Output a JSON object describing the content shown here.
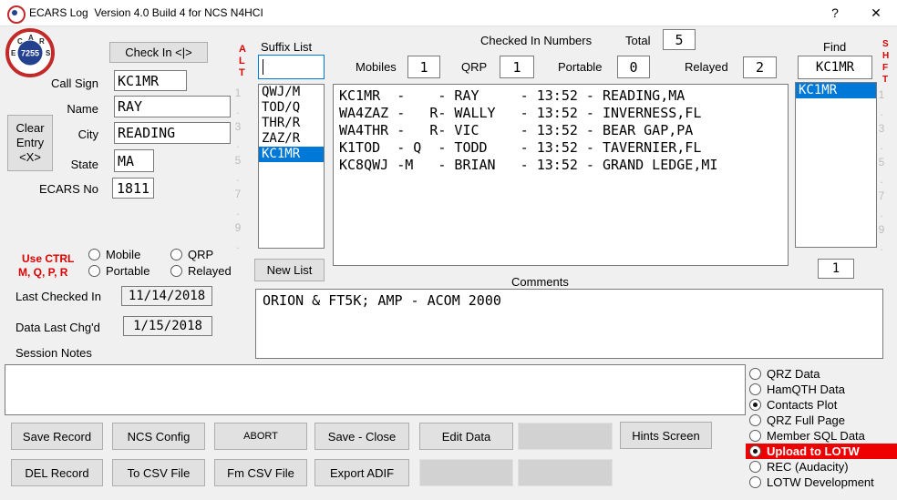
{
  "window": {
    "title": "ECARS Log  Version 4.0 Build 4 for NCS N4HCI",
    "help": "?",
    "close": "✕"
  },
  "colors": {
    "accent_blue": "#0078d7",
    "alert_red": "#dd0000",
    "lotw_highlight_bg": "#ee0000"
  },
  "logo": {
    "number": "7255",
    "letters": [
      "E",
      "C",
      "A",
      "R",
      "S"
    ]
  },
  "left_form": {
    "check_in_button": "Check In <|>",
    "clear_entry": [
      "Clear",
      "Entry",
      "<X>"
    ],
    "fields": {
      "call_sign": {
        "label": "Call Sign",
        "value": "KC1MR"
      },
      "name": {
        "label": "Name",
        "value": "RAY"
      },
      "city": {
        "label": "City",
        "value": "READING"
      },
      "state": {
        "label": "State",
        "value": "MA"
      },
      "ecars_no": {
        "label": "ECARS No",
        "value": "1811"
      }
    }
  },
  "alt_hint": {
    "letters": [
      "A",
      "L",
      "T"
    ]
  },
  "shft_hint": {
    "letters": [
      "S",
      "H",
      "F",
      "T"
    ]
  },
  "row_numbers": [
    "1",
    ".",
    "3",
    ".",
    "5",
    ".",
    "7",
    ".",
    "9",
    "."
  ],
  "suffix_panel": {
    "label": "Suffix List",
    "input_value": "",
    "items": [
      "QWJ/M",
      "TOD/Q",
      "THR/R",
      "ZAZ/R",
      "KC1MR"
    ],
    "new_list_button": "New List"
  },
  "stats": {
    "header": "Checked In Numbers",
    "total_label": "Total",
    "total_value": "5",
    "counters": [
      {
        "label": "Mobiles",
        "value": "1"
      },
      {
        "label": "QRP",
        "value": "1"
      },
      {
        "label": "Portable",
        "value": "0"
      },
      {
        "label": "Relayed",
        "value": "2"
      }
    ]
  },
  "checkin_list": {
    "rows": [
      "KC1MR  -    - RAY     - 13:52 - READING,MA",
      "WA4ZAZ -   R- WALLY   - 13:52 - INVERNESS,FL",
      "WA4THR -   R- VIC     - 13:52 - BEAR GAP,PA",
      "K1TOD  - Q  - TODD    - 13:52 - TAVERNIER,FL",
      "KC8QWJ -M   - BRIAN   - 13:52 - GRAND LEDGE,MI"
    ]
  },
  "find_panel": {
    "label": "Find",
    "input_value": "KC1MR",
    "items": [
      "KC1MR"
    ],
    "count_value": "1"
  },
  "status_radios": {
    "hint_line1": "Use CTRL",
    "hint_line2": "M, Q, P, R",
    "options": [
      "Mobile",
      "QRP",
      "Portable",
      "Relayed"
    ]
  },
  "dates": {
    "last_checked_label": "Last Checked In",
    "last_checked_value": "11/14/2018",
    "data_changed_label": "Data Last Chg'd",
    "data_changed_value": "1/15/2018"
  },
  "comments": {
    "label": "Comments",
    "value": "ORION & FT5K; AMP - ACOM 2000"
  },
  "session_notes": {
    "label": "Session Notes",
    "value": ""
  },
  "buttons": {
    "row1": [
      "Save Record",
      "NCS Config",
      "ABORT",
      "Save - Close",
      "Edit Data",
      "",
      "Hints Screen"
    ],
    "row2": [
      "DEL Record",
      "To CSV File",
      "Fm CSV File",
      "Export ADIF",
      "",
      ""
    ]
  },
  "output_radios": {
    "options": [
      {
        "label": "QRZ Data",
        "selected": false
      },
      {
        "label": "HamQTH Data",
        "selected": false
      },
      {
        "label": "Contacts Plot",
        "selected": true
      },
      {
        "label": "QRZ Full Page",
        "selected": false
      },
      {
        "label": "Member SQL Data",
        "selected": false
      },
      {
        "label": "Upload to LOTW",
        "selected": true,
        "highlighted": true
      },
      {
        "label": "REC (Audacity)",
        "selected": false
      },
      {
        "label": "LOTW Development",
        "selected": false
      }
    ]
  }
}
